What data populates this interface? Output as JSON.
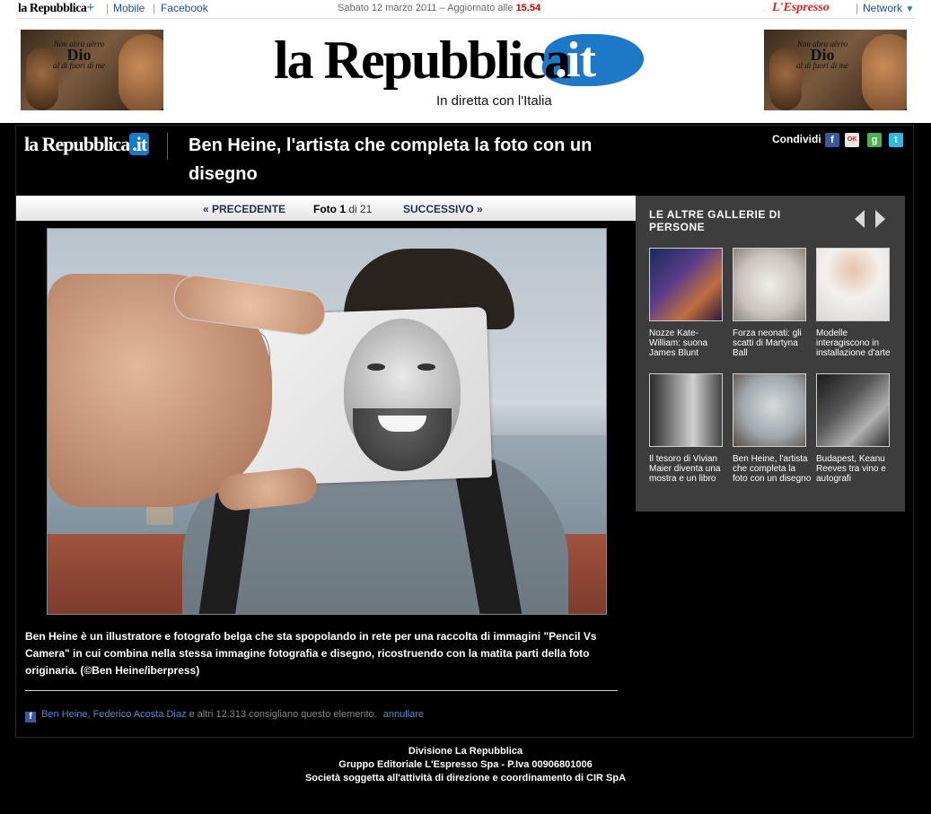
{
  "topbar": {
    "logo": "la Repubblica",
    "logo_plus": "+",
    "mobile": "Mobile",
    "separator": "|",
    "facebook": "Facebook",
    "date_prefix": "Sabato 12 marzo 2011 – Aggiornato alle",
    "time": "15.54",
    "espresso": "L'Espresso",
    "network": "Network",
    "network_caret": "▼"
  },
  "ads": {
    "tattoo_top": "Non abra aêrro",
    "tattoo_big": "Dio",
    "tattoo_bottom": "al di fuori di me"
  },
  "masthead": {
    "word": "la Repubblica",
    "dot_it": ".it",
    "tagline": "In diretta con l'Italia"
  },
  "header": {
    "logo": "la Repubblica",
    "logo_it": ".it",
    "title": "Ben Heine, l'artista che completa la foto con un disegno",
    "share_label": "Condividi",
    "share_icons": [
      "f",
      "OK",
      "g",
      "t"
    ]
  },
  "nav": {
    "prev": "« PRECEDENTE",
    "foto_label": "Foto",
    "current": "1",
    "of": "di 21",
    "next": "SUCCESSIVO »"
  },
  "caption": "Ben Heine è un  illustratore e fotografo belga che sta spopolando in rete per una raccolta di immagini \"Pencil Vs Camera\"  in cui combina nella stessa immagine fotografia e disegno, ricostruendo con la matita parti della foto originaria. (©Ben Heine/iberpress)",
  "facebook_like": {
    "icon": "f",
    "name1": "Ben Heine",
    "comma": ",",
    "name2": "Federico Acosta Diaz",
    "rest": "e altri 12.313 consigliano questo elemento.",
    "undo": "annullare"
  },
  "sidebar": {
    "title": "LE ALTRE GALLERIE DI PERSONE",
    "galleries": [
      {
        "caption": "Nozze Kate-William: suona James Blunt"
      },
      {
        "caption": "Forza neonati: gli scatti di Martyna Ball"
      },
      {
        "caption": "Modelle interagiscono in installazione d'arte"
      },
      {
        "caption": "Il tesoro di Vivian Maier diventa una mostra e un libro"
      },
      {
        "caption": "Ben Heine, l'artista che completa la foto con un disegno"
      },
      {
        "caption": "Budapest, Keanu Reeves tra vino e autografi"
      }
    ]
  },
  "footer": {
    "line1": "Divisione La Repubblica",
    "line2": "Gruppo Editoriale L'Espresso Spa - P.Iva 00906801006",
    "line3": "Società soggetta all'attività di direzione e coordinamento di CIR SpA"
  },
  "colors": {
    "brand_blue": "#1e78c8",
    "link_blue": "#1b4f9c",
    "time_red": "#cc0000",
    "espresso_red": "#e2231a",
    "sidebar_bg": "#3d3d3d"
  }
}
